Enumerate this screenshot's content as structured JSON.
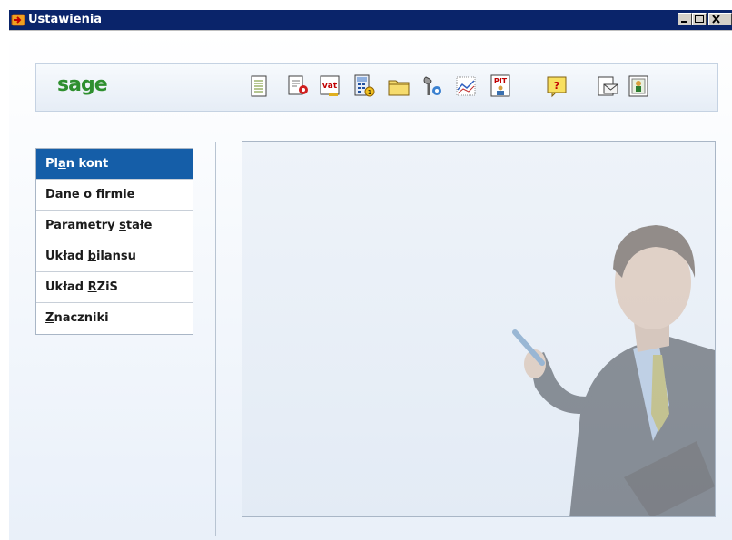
{
  "window": {
    "title": "Ustawienia",
    "minimize_label": "_",
    "maximize_label": "□",
    "close_label": "×"
  },
  "brand": {
    "logo": "sage"
  },
  "toolbar": {
    "icons": [
      "journal-icon",
      "settings-document-icon",
      "vat-icon",
      "calculator-icon",
      "folder-icon",
      "tools-icon",
      "chart-icon",
      "pit-icon",
      "help-icon",
      "mail-icon",
      "contact-card-icon"
    ],
    "pit_label": "PIT",
    "vat_label": "vat",
    "help_label": "?"
  },
  "nav": {
    "items": [
      {
        "pre": "Pl",
        "key": "a",
        "post": "n kont",
        "active": true
      },
      {
        "pre": "Dane o f",
        "key": "i",
        "post": "rmie",
        "active": false
      },
      {
        "pre": "Parametry ",
        "key": "s",
        "post": "tałe",
        "active": false
      },
      {
        "pre": "Układ ",
        "key": "b",
        "post": "ilansu",
        "active": false
      },
      {
        "pre": "Układ ",
        "key": "R",
        "post": "ZiS",
        "active": false
      },
      {
        "pre": "",
        "key": "Z",
        "post": "naczniki",
        "active": false
      }
    ]
  },
  "colors": {
    "titlebar": "#0a246a",
    "active_item": "#155ea8",
    "brand_green": "#2f8f2f"
  }
}
